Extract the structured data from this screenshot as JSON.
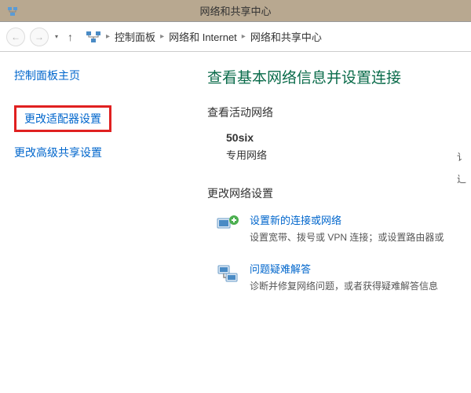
{
  "titlebar": {
    "title": "网络和共享中心"
  },
  "breadcrumb": {
    "items": [
      "控制面板",
      "网络和 Internet",
      "网络和共享中心"
    ]
  },
  "sidebar": {
    "home": "控制面板主页",
    "adapter_settings": "更改适配器设置",
    "advanced_sharing": "更改高级共享设置"
  },
  "main": {
    "heading": "查看基本网络信息并设置连接",
    "active_networks_heading": "查看活动网络",
    "network": {
      "name": "50six",
      "type": "专用网络"
    },
    "right_labels": [
      "讠",
      "辶"
    ],
    "change_settings_heading": "更改网络设置",
    "new_connection": {
      "link": "设置新的连接或网络",
      "desc": "设置宽带、拨号或 VPN 连接；或设置路由器或"
    },
    "troubleshoot": {
      "link": "问题疑难解答",
      "desc": "诊断并修复网络问题，或者获得疑难解答信息"
    }
  }
}
